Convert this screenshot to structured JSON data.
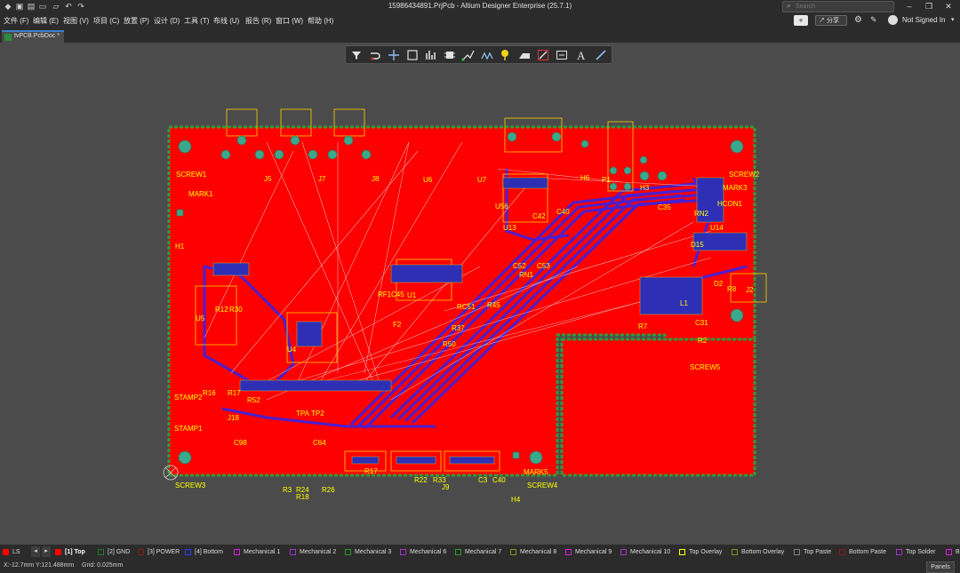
{
  "window": {
    "title": "15986434891.PrjPcb - Altium Designer Enterprise (25.7.1)"
  },
  "search": {
    "placeholder": "Search"
  },
  "menu": [
    "文件 (F)",
    "编辑 (E)",
    "视图 (V)",
    "项目 (C)",
    "放置 (P)",
    "设计 (D)",
    "工具 (T)",
    "布线 (U)",
    "报告 (R)",
    "窗口 (W)",
    "帮助 (H)"
  ],
  "header_right": {
    "share": "分享",
    "user": "Not Signed In"
  },
  "doc_tab": {
    "label": "tvPCB.PcbDoc *"
  },
  "toolbar_icons": [
    "filter-icon",
    "interactive-route-icon",
    "cross-icon",
    "rectangle-select-icon",
    "chart-icon",
    "component-icon",
    "route-icon",
    "diff-pair-icon",
    "pad-icon",
    "polygon-icon",
    "region-icon",
    "dimension-icon",
    "text-icon",
    "line-icon"
  ],
  "colors": {
    "board": "#ff0000",
    "board_outline": "#2f9a3a",
    "bottom_track": "#4b1fcf",
    "designator": "#ffff00",
    "overlay": "#ffd000",
    "pad": "#3aa88a",
    "ratsnest": "#dcdcdc"
  },
  "designators": [
    "SCREW1",
    "J5",
    "J7",
    "J8",
    "U6",
    "U7",
    "H6",
    "P1",
    "SCREW2",
    "MARK1",
    "H3",
    "C35",
    "MARK3",
    "HCON1",
    "RN2",
    "U14",
    "D15",
    "H1",
    "U56",
    "C42",
    "C40",
    "U13",
    "C52",
    "C53",
    "RN1",
    "RF1",
    "C45",
    "U1",
    "RC51",
    "R45",
    "F2",
    "R37",
    "R50",
    "R30",
    "U5",
    "R12",
    "U4",
    "STAMP2",
    "STAMP1",
    "R16",
    "R17",
    "R52",
    "J18",
    "C98",
    "C64",
    "TPA",
    "TP2",
    "R7",
    "L1",
    "C31",
    "R2",
    "D2",
    "R8",
    "J2",
    "SCREW5",
    "SCREW3",
    "R3",
    "R24",
    "R18",
    "R26",
    "R17",
    "R22",
    "R33",
    "J9",
    "C3",
    "C40",
    "SCREW4",
    "MARK5",
    "H4"
  ],
  "layers": [
    {
      "label": "LS",
      "color": "#ff0000"
    },
    {
      "label": "[1] Top",
      "color": "#ff0000"
    },
    {
      "label": "[2] GND",
      "color": "#1f7a2a"
    },
    {
      "label": "[3] POWER",
      "color": "#8a1a1a"
    },
    {
      "label": "[4] Bottom",
      "color": "#2a3dff"
    },
    {
      "label": "Mechanical 1",
      "color": "#d61fd6"
    },
    {
      "label": "Mechanical 2",
      "color": "#a035c8"
    },
    {
      "label": "Mechanical 3",
      "color": "#2a9a2a"
    },
    {
      "label": "Mechanical 6",
      "color": "#a035c8"
    },
    {
      "label": "Mechanical 7",
      "color": "#2a9a2a"
    },
    {
      "label": "Mechanical 8",
      "color": "#8a8a20"
    },
    {
      "label": "Mechanical 9",
      "color": "#d61fd6"
    },
    {
      "label": "Mechanical 10",
      "color": "#a035c8"
    },
    {
      "label": "Top Overlay",
      "color": "#ffff00"
    },
    {
      "label": "Bottom Overlay",
      "color": "#8a8a20"
    },
    {
      "label": "Top Paste",
      "color": "#808080"
    },
    {
      "label": "Bottom Paste",
      "color": "#8a1a1a"
    },
    {
      "label": "Top Solder",
      "color": "#a035c8"
    },
    {
      "label": "B",
      "color": "#d61fd6"
    }
  ],
  "status": {
    "coords": "X:-12.7mm Y:121.488mm",
    "grid": "Grid: 0.025mm",
    "panels": "Panels"
  }
}
